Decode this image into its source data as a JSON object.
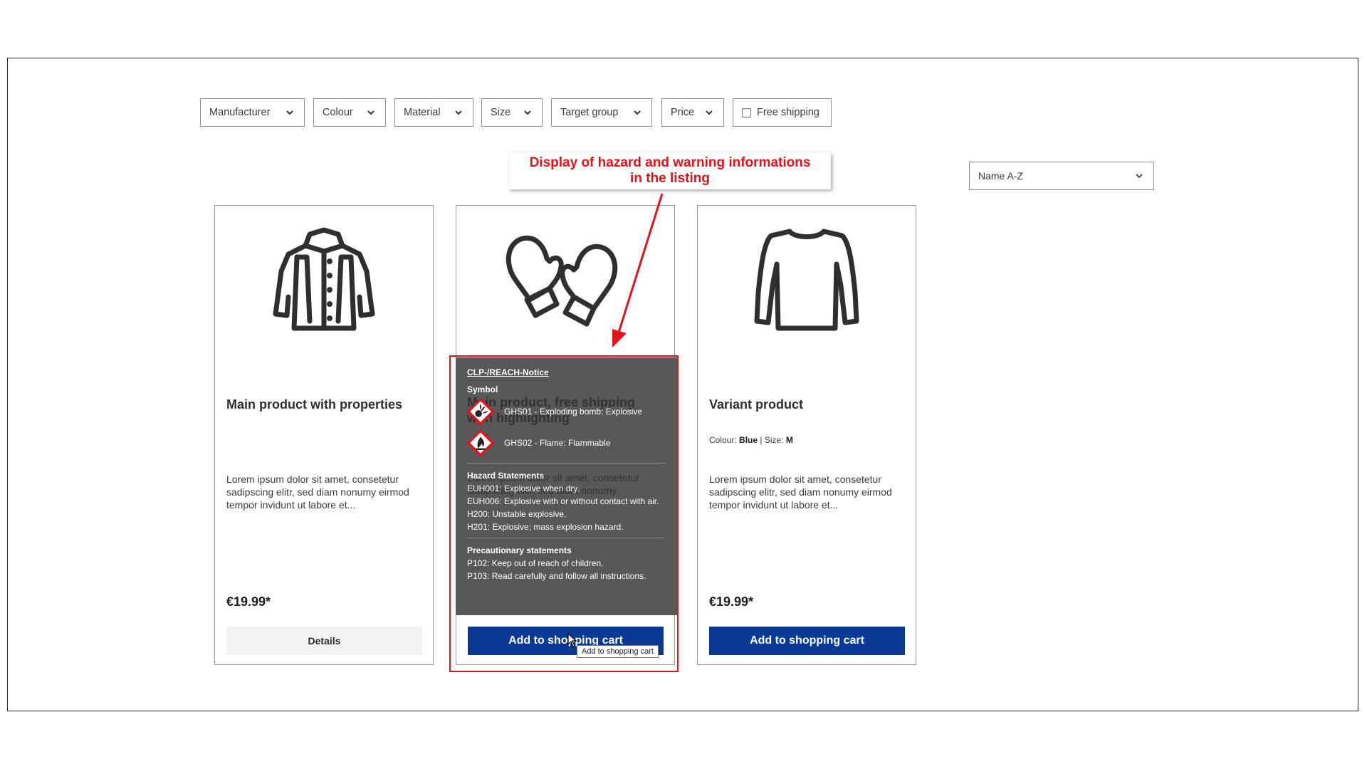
{
  "filters": [
    {
      "label": "Manufacturer"
    },
    {
      "label": "Colour"
    },
    {
      "label": "Material"
    },
    {
      "label": "Size"
    },
    {
      "label": "Target group"
    },
    {
      "label": "Price"
    }
  ],
  "free_shipping_label": "Free shipping",
  "sort": {
    "selected": "Name A-Z"
  },
  "annotation": {
    "line1": "Display of hazard and warning informations",
    "line2": "in the listing"
  },
  "products": [
    {
      "title": "Main product with properties",
      "description": "Lorem ipsum dolor sit amet, consetetur sadipscing elitr, sed diam nonumy eirmod tempor invidunt ut labore et...",
      "price": "€19.99*",
      "button": "Details"
    },
    {
      "title": "Main product, free shipping with highlighting",
      "description": "Lorem ipsum dolor sit amet, consetetur sadipscing elitr, sed diam nonumy",
      "button": "Add to shopping cart"
    },
    {
      "title": "Variant product",
      "props": {
        "colour_label": "Colour:",
        "colour_value": "Blue",
        "size_label": "Size:",
        "size_value": "M"
      },
      "description": "Lorem ipsum dolor sit amet, consetetur sadipscing elitr, sed diam nonumy eirmod tempor invidunt ut labore et...",
      "price": "€19.99*",
      "button": "Add to shopping cart"
    }
  ],
  "hazard": {
    "heading": "CLP-/REACH-Notice",
    "symbol_heading": "Symbol",
    "symbols": [
      {
        "icon": "ghs01-exploding-bomb-icon",
        "text": "GHS01 - Exploding bomb: Explosive"
      },
      {
        "icon": "ghs02-flame-icon",
        "text": "GHS02 - Flame: Flammable"
      }
    ],
    "hazard_heading": "Hazard Statements",
    "hazard_lines": [
      "EUH001: Explosive when dry.",
      "EUH006: Explosive with or without contact with air.",
      "H200: Unstable explosive.",
      "H201: Explosive; mass explosion hazard."
    ],
    "precaution_heading": "Precautionary statements",
    "precaution_lines": [
      "P102: Keep out of reach of children.",
      "P103: Read carefully and follow all instructions."
    ]
  },
  "tooltip": "Add to shopping cart",
  "colors": {
    "accent": "#0a3a94",
    "annotation": "#e3121b",
    "overlay": "#585858"
  }
}
